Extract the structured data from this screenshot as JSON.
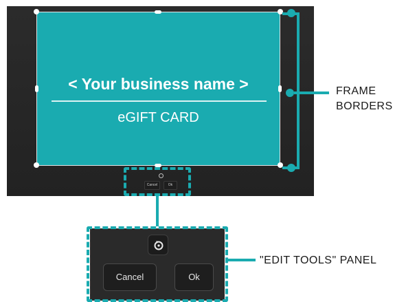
{
  "card": {
    "title": "< Your business name >",
    "subtitle": "eGIFT CARD",
    "color": "#1aabb0"
  },
  "mini_tools": {
    "cancel_label": "Cancel",
    "ok_label": "Ok"
  },
  "edit_tools_panel": {
    "rotate_icon": "rotate-icon",
    "cancel_label": "Cancel",
    "ok_label": "Ok"
  },
  "callouts": {
    "frame_borders_line1": "FRAME",
    "frame_borders_line2": "BORDERS",
    "edit_tools": "\"EDIT TOOLS\" PANEL"
  },
  "colors": {
    "accent": "#1aabb0",
    "editor_bg": "#272727"
  }
}
